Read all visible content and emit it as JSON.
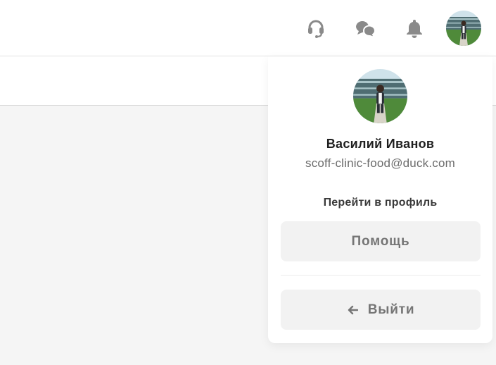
{
  "header": {
    "icons": {
      "support": "headset-icon",
      "chat": "chat-bubbles-icon",
      "notifications": "bell-icon"
    },
    "icon_color": "#8a8a8a"
  },
  "profile_menu": {
    "user_name": "Василий Иванов",
    "email": "scoff-clinic-food@duck.com",
    "profile_link": "Перейти в профиль",
    "help_label": "Помощь",
    "logout_label": "Выйти",
    "logout_icon": "arrow-left-icon"
  },
  "colors": {
    "page_bg": "#f5f5f5",
    "surface": "#ffffff",
    "button_bg": "#f2f2f2",
    "text_primary": "#1f1f1f",
    "text_secondary": "#6b6b6b"
  }
}
